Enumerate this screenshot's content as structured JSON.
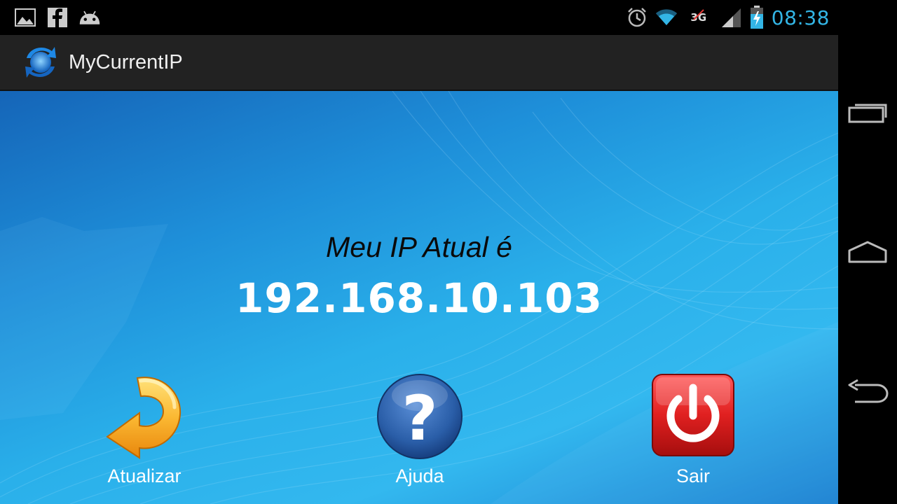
{
  "status_bar": {
    "time": "08:38",
    "network_type": "3G",
    "icons": [
      "gallery-icon",
      "facebook-icon",
      "android-icon",
      "alarm-icon",
      "wifi-icon",
      "signal-icon",
      "battery-charging-icon"
    ],
    "clock_color": "#33b5e5"
  },
  "action_bar": {
    "title": "MyCurrentIP",
    "app_icon": "refresh-globe-icon"
  },
  "main": {
    "ip_label": "Meu IP Atual é",
    "ip_address": "192.168.10.103"
  },
  "buttons": {
    "refresh": {
      "label": "Atualizar",
      "icon": "refresh-arrow-icon",
      "color": "#f5a623"
    },
    "help": {
      "label": "Ajuda",
      "icon": "question-mark-icon",
      "color": "#2a5ea8"
    },
    "exit": {
      "label": "Sair",
      "icon": "power-icon",
      "color": "#d81e1e"
    }
  },
  "nav_bar": {
    "items": [
      "recent-apps-icon",
      "home-icon",
      "back-icon"
    ]
  }
}
